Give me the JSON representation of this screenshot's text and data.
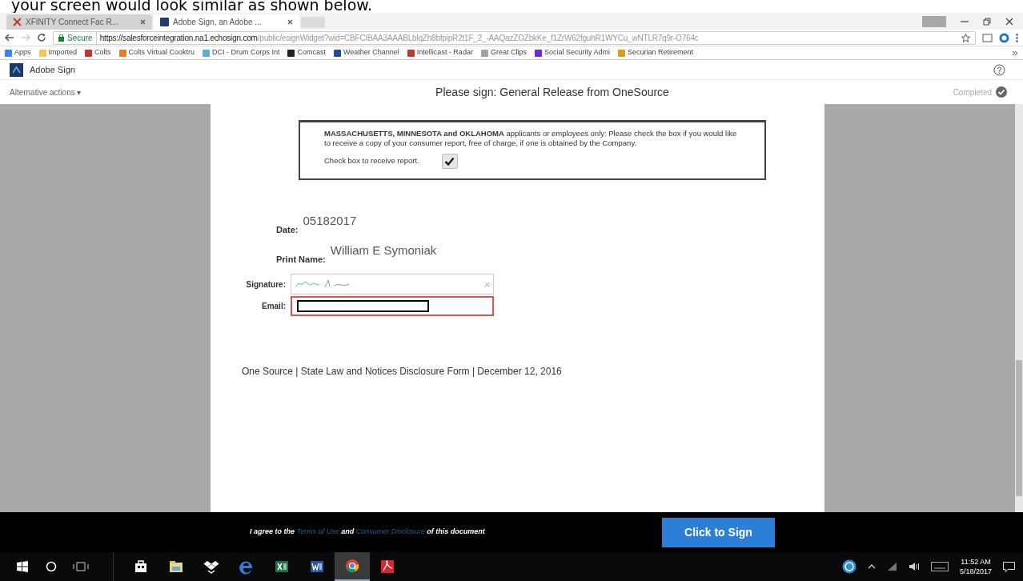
{
  "caption": "your screen would look similar as shown below.",
  "tabs": [
    {
      "title": "XFINITY Connect Fac R...",
      "selected": false
    },
    {
      "title": "Adobe Sign, an Adobe ...",
      "selected": true
    }
  ],
  "address": {
    "security": "Secure",
    "host": "https://salesforceintegration.na1.echosign.com",
    "path": "/public/esignWidget?wid=CBFCIBAA3AAABLblqZh8bfpipR2t1F_2_-AAQazZOZbkKe_f1ZrW62fguhR1WYCu_wNTLR7q9r-O764c"
  },
  "bookmarks": [
    {
      "label": "Apps",
      "color": "#3b82f6"
    },
    {
      "label": "Imported",
      "color": "#f2c94c"
    },
    {
      "label": "Colts",
      "color": "#c0392b"
    },
    {
      "label": "Colts Virtual Cooktru",
      "color": "#e67e22"
    },
    {
      "label": "DCI - Drum Corps Int",
      "color": "#5dade2"
    },
    {
      "label": "Comcast",
      "color": "#222222"
    },
    {
      "label": "Weather Channel",
      "color": "#1f4e9c"
    },
    {
      "label": "Intellicast - Radar",
      "color": "#c0392b"
    },
    {
      "label": "Great Clips",
      "color": "#9ca3af"
    },
    {
      "label": "Social Security Admi",
      "color": "#6d28d9"
    },
    {
      "label": "Securian Retirement",
      "color": "#d4a017"
    }
  ],
  "app": {
    "brand": "Adobe Sign",
    "actions": "Alternative actions ▾",
    "title": "Please sign: General Release from OneSource",
    "status": "Completed"
  },
  "document": {
    "notice": "**MASSACHUSETTS, MINNESOTA and OKLAHOMA** applicants or employees only: Please check the box if you would like to receive a copy of your consumer report, free of charge, if one is obtained by the Company.",
    "checkbox": {
      "label": "Check box to receive report.",
      "checked": true
    },
    "fields": [
      {
        "label": "Date:",
        "value": "05182017"
      },
      {
        "label": "Print Name:",
        "value": "William E Symoniak"
      }
    ],
    "signature_label": "Signature:",
    "email_label": "Email:",
    "footer": "One Source | State Law and Notices Disclosure Form | December 12, 2016"
  },
  "agree": {
    "lead": "I agree to the",
    "terms": "Terms of Use",
    "and": "and",
    "disclosure": "Consumer Disclosure",
    "tail": "of this document"
  },
  "sign_button": "Click to Sign",
  "taskbar": {
    "apps": [
      {
        "kind": "store",
        "active": false
      },
      {
        "kind": "files",
        "active": false
      },
      {
        "kind": "dropbox",
        "active": false
      },
      {
        "kind": "edge",
        "active": false
      },
      {
        "kind": "excel",
        "active": false
      },
      {
        "kind": "word",
        "active": false
      },
      {
        "kind": "chrome",
        "active": true
      },
      {
        "kind": "pdf",
        "active": false
      }
    ],
    "time": "11:52 AM",
    "date": "5/18/2017"
  }
}
